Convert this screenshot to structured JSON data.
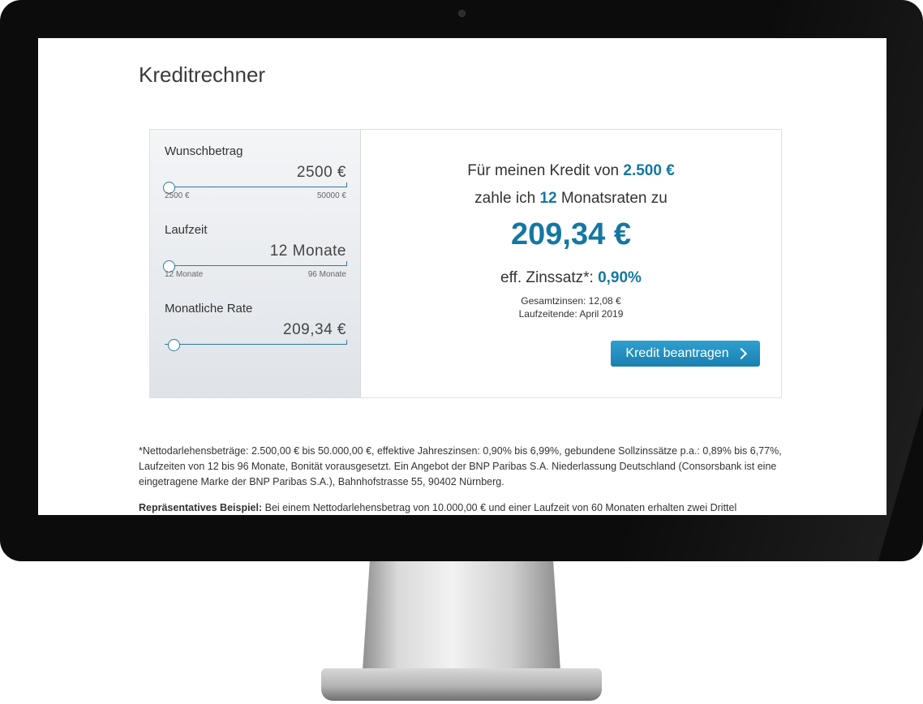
{
  "page": {
    "title": "Kreditrechner"
  },
  "calculator": {
    "amount": {
      "label": "Wunschbetrag",
      "value": "2500 €",
      "min": "2500 €",
      "max": "50000 €",
      "position": 0.0
    },
    "term": {
      "label": "Laufzeit",
      "value": "12 Monate",
      "min": "12 Monate",
      "max": "96 Monate",
      "position": 0.0
    },
    "monthly": {
      "label": "Monatliche Rate",
      "value": "209,34 €",
      "position": 0.03
    },
    "summary": {
      "line1_prefix": "Für meinen Kredit von",
      "line1_amount": "2.500 €",
      "line2_prefix": "zahle ich",
      "line2_count": "12",
      "line2_suffix": "Monatsraten zu",
      "rate": "209,34 €",
      "zins_label": "eff. Zinssatz*:",
      "zins_value": "0,90%",
      "total_interest": "Gesamtzinsen: 12,08 €",
      "end_date": "Laufzeitende: April 2019"
    },
    "apply_button": "Kredit beantragen"
  },
  "footnote": "*Nettodarlehensbeträge: 2.500,00 € bis 50.000,00 €, effektive Jahreszinsen: 0,90% bis 6,99%, gebundene Sollzinssätze p.a.: 0,89% bis 6,77%, Laufzeiten von 12 bis 96 Monate, Bonität vorausgesetzt. Ein Angebot der BNP Paribas S.A. Niederlassung Deutschland (Consorsbank ist eine eingetragene Marke der BNP Paribas S.A.), Bahnhofstrasse 55, 90402 Nürnberg.",
  "example": {
    "label": "Repräsentatives Beispiel:",
    "text": "Bei einem Nettodarlehensbetrag von 10.000,00 € und einer Laufzeit von 60 Monaten erhalten zwei Drittel"
  },
  "colors": {
    "accent": "#1577a3",
    "button": "#1b7fb0",
    "bezel": "#0c0c0c"
  }
}
